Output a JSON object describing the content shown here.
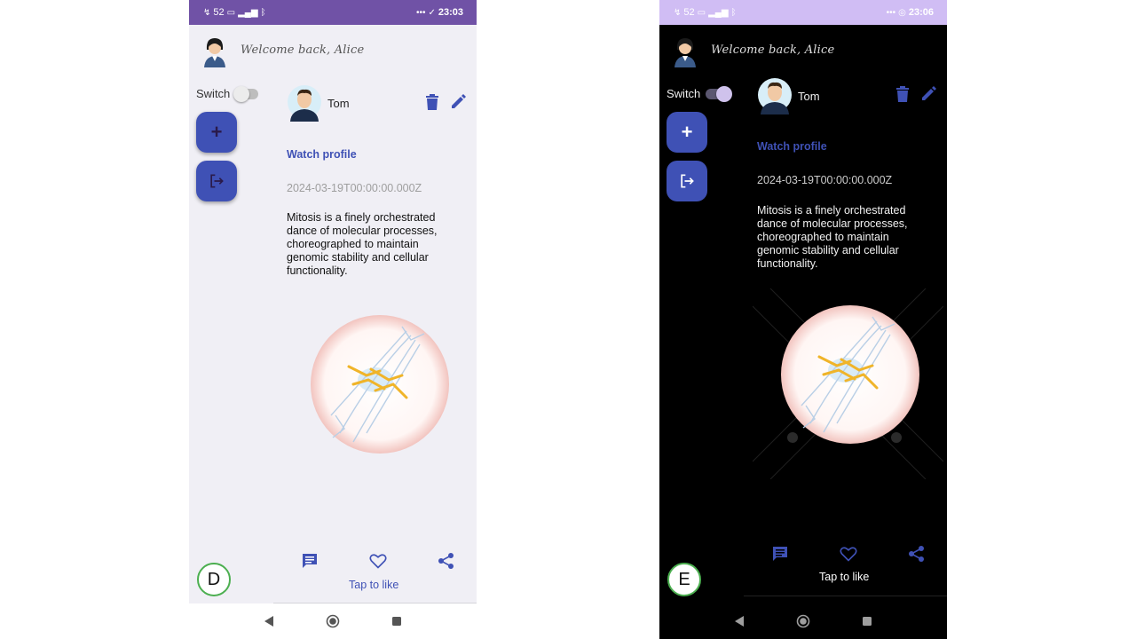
{
  "colors": {
    "accent": "#3f51b5",
    "badge_border": "#4caf50",
    "light_status_bar": "#7052a6",
    "dark_status_bar": "#d0bdf4"
  },
  "light": {
    "status": {
      "signal_text": "52",
      "time": "23:03"
    },
    "header": {
      "welcome": "Welcome back, Alice"
    },
    "switch_label": "Switch",
    "post": {
      "author": "Tom",
      "watch_profile": "Watch profile",
      "date": "2024-03-19T00:00:00.000Z",
      "body": "Mitosis is a finely orchestrated dance of molecular processes, choreographed to maintain genomic stability and cellular functionality."
    },
    "tap_like": "Tap to like",
    "badge": "D"
  },
  "dark": {
    "status": {
      "signal_text": "52",
      "time": "23:06"
    },
    "header": {
      "welcome": "Welcome back, Alice"
    },
    "switch_label": "Switch",
    "post": {
      "author": "Tom",
      "watch_profile": "Watch profile",
      "date": "2024-03-19T00:00:00.000Z",
      "body": "Mitosis is a finely orchestrated dance of molecular processes, choreographed to maintain genomic stability and cellular functionality."
    },
    "tap_like": "Tap to like",
    "badge": "E"
  },
  "icons": [
    "avatar-icon",
    "delete-icon",
    "edit-icon",
    "add-icon",
    "logout-icon",
    "comment-icon",
    "heart-icon",
    "share-icon",
    "back-icon",
    "home-icon",
    "recents-icon"
  ]
}
